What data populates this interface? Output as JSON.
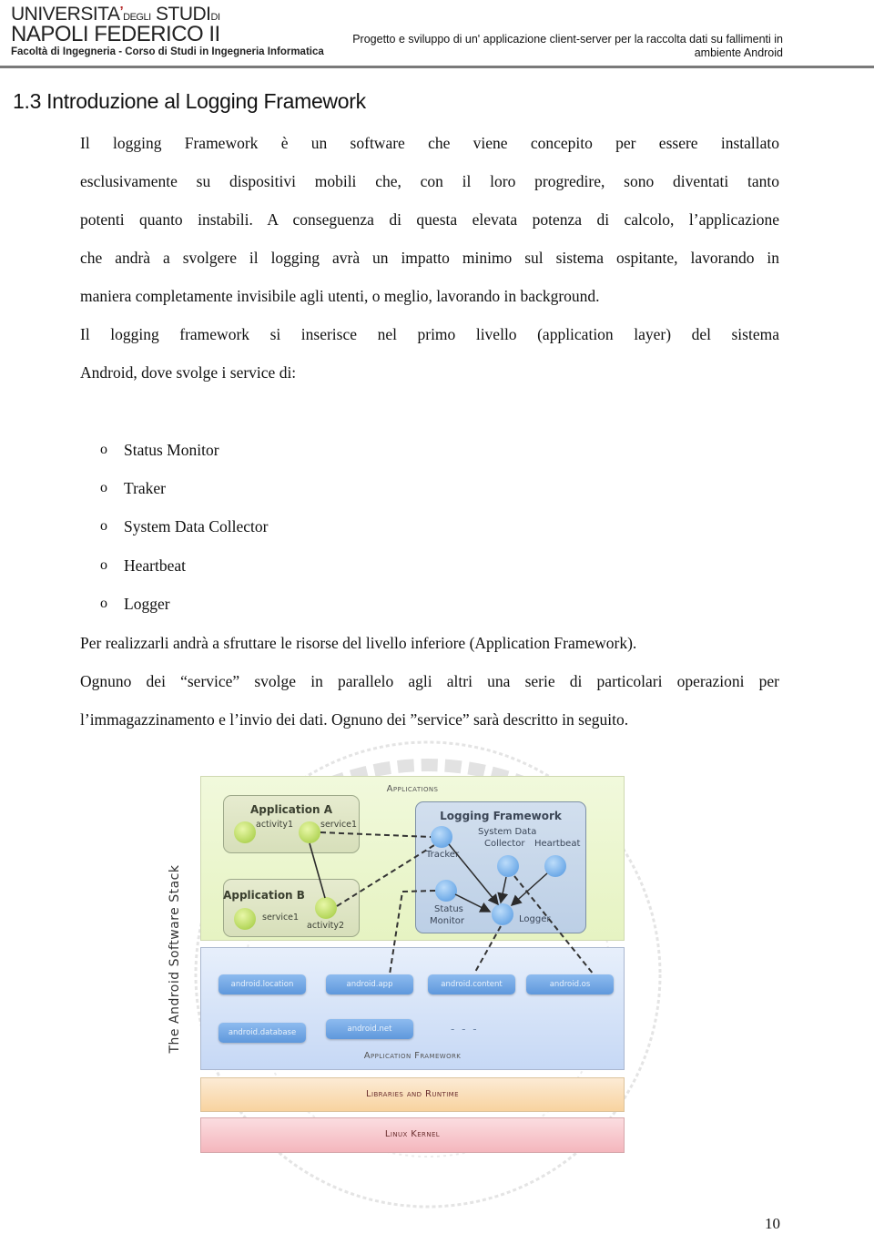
{
  "header": {
    "logo": {
      "line1_main": "UNIVERSITA",
      "line1_small": "DEGLI",
      "line1_studi": "STUDI",
      "line1_di": "DI",
      "line2": "NAPOLI FEDERICO II",
      "line3": "Facoltà di Ingegneria - Corso di Studi in Ingegneria Informatica"
    },
    "document_title_line1": "Progetto e sviluppo di un' applicazione client-server per la raccolta dati su fallimenti in",
    "document_title_line2": "ambiente Android"
  },
  "section": {
    "title": "1.3 Introduzione al Logging Framework"
  },
  "body": {
    "para1_lines": [
      "Il logging Framework è un software che viene concepito per essere installato",
      "esclusivamente su dispositivi mobili che, con il loro progredire, sono diventati tanto",
      "potenti quanto instabili. A conseguenza di questa elevata potenza di calcolo, l’applicazione",
      "che andrà a svolgere il logging avrà un impatto minimo sul sistema ospitante, lavorando in"
    ],
    "para1_last": "maniera completamente invisibile agli utenti, o meglio, lavorando in background.",
    "para2_line1": "Il logging framework si inserisce nel primo livello (application layer) del sistema",
    "para2_last": "Android, dove svolge i service di:",
    "bullet_marker": "o",
    "services": [
      "Status Monitor",
      "Traker",
      "System Data Collector",
      "Heartbeat",
      "Logger"
    ],
    "para3": "Per realizzarli andrà a sfruttare le risorse del livello inferiore (Application Framework).",
    "para4_line1": "Ognuno dei “service” svolge in parallelo agli altri una serie di particolari operazioni per",
    "para4_last": "l’immagazzinamento e l’invio dei dati. Ognuno dei ”service” sarà descritto in seguito."
  },
  "diagram": {
    "side_label": "The Android Software Stack",
    "layers": {
      "applications": "Applications",
      "application_framework": "Application Framework",
      "libraries": "Libraries and Runtime",
      "kernel": "Linux Kernel"
    },
    "application_a": {
      "title": "Application A",
      "nodes": [
        "activity1",
        "service1"
      ]
    },
    "application_b": {
      "title": "Application B",
      "nodes": [
        "service1",
        "activity2"
      ]
    },
    "logging_framework": {
      "title": "Logging Framework",
      "nodes": {
        "tracker": "Tracker",
        "system_data_collector_1": "System Data",
        "system_data_collector_2": "Collector",
        "heartbeat": "Heartbeat",
        "status_monitor_1": "Status",
        "status_monitor_2": "Monitor",
        "logger": "Logger"
      }
    },
    "packages": [
      "android.location",
      "android.app",
      "android.content",
      "android.os",
      "android.database",
      "android.net"
    ],
    "ellipsis": "- - -",
    "colors": {
      "applications_layer": "#e9f5c8",
      "framework_layer": "#d3e1f7",
      "libraries_layer": "#f9dcb3",
      "kernel_layer": "#f7c6cb",
      "green_node": "#b4d65a",
      "blue_node": "#74aee9"
    }
  },
  "footer": {
    "page_number": "10"
  }
}
